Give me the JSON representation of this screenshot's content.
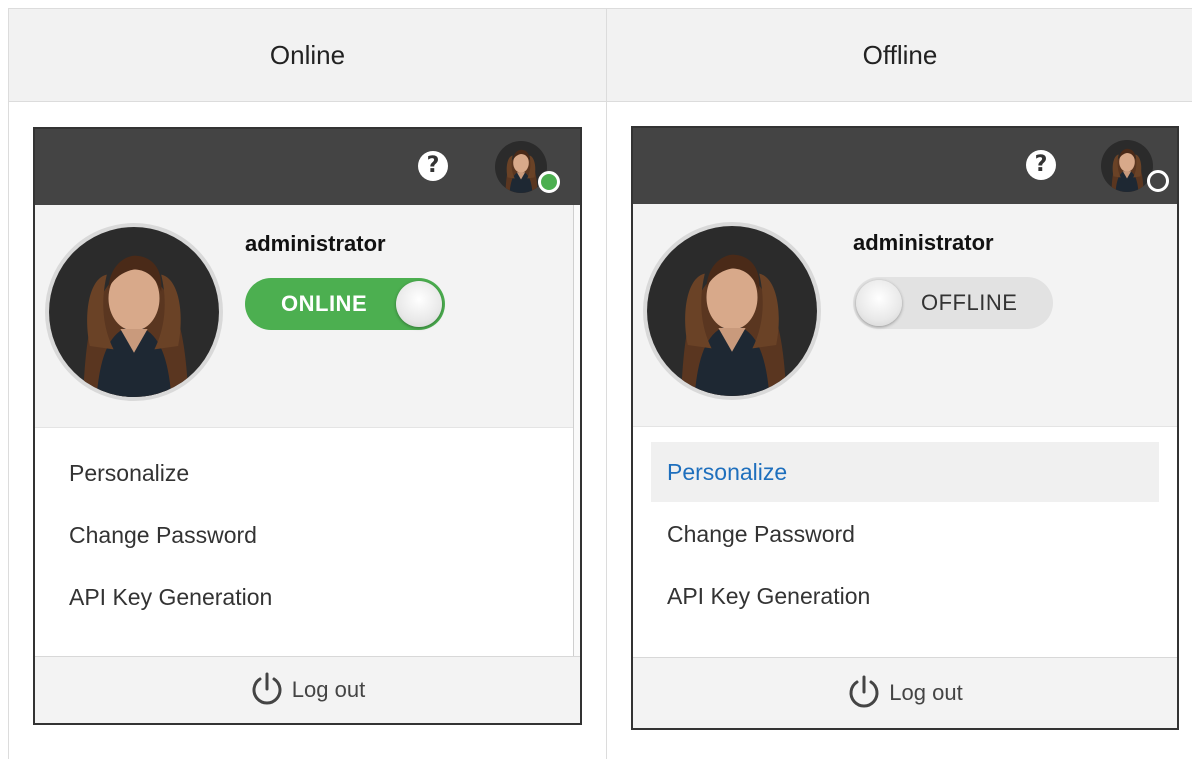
{
  "columns": [
    {
      "header": "Online",
      "panel": {
        "username": "administrator",
        "status_label": "ONLINE",
        "status": "online",
        "menu": [
          "Personalize",
          "Change Password",
          "API Key Generation"
        ],
        "logout_label": "Log out",
        "help_glyph": "?"
      }
    },
    {
      "header": "Offline",
      "panel": {
        "username": "administrator",
        "status_label": "OFFLINE",
        "status": "offline",
        "menu": [
          "Personalize",
          "Change Password",
          "API Key Generation"
        ],
        "highlighted_item": "Personalize",
        "logout_label": "Log out",
        "help_glyph": "?"
      }
    }
  ],
  "colors": {
    "topbar": "#444444",
    "online_green": "#4caf50",
    "link_blue": "#1e6fbd"
  },
  "icons": {
    "help": "question-circle-icon",
    "power": "power-icon",
    "status_online": "green-dot",
    "status_offline": "hollow-dot"
  }
}
